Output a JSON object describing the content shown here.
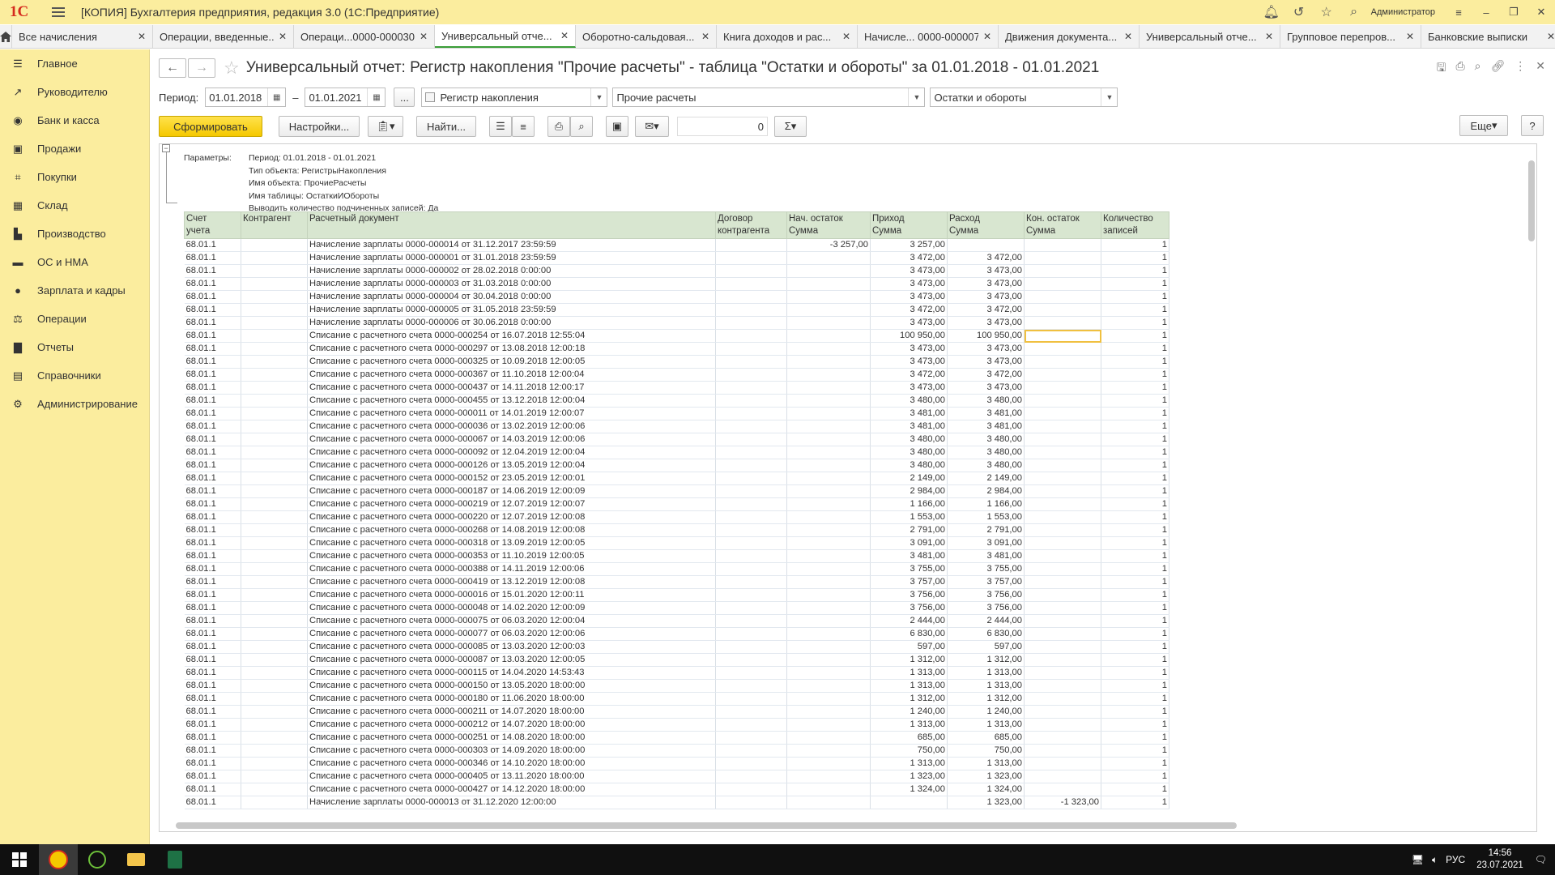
{
  "app": {
    "logo": "1С",
    "title": "[КОПИЯ] Бухгалтерия предприятия, редакция 3.0  (1С:Предприятие)",
    "user": "Администратор"
  },
  "tabs": [
    {
      "label": "Все начисления"
    },
    {
      "label": "Операции, введенные..."
    },
    {
      "label": "Операци...0000-000030"
    },
    {
      "label": "Универсальный отче...",
      "active": true
    },
    {
      "label": "Оборотно-сальдовая..."
    },
    {
      "label": "Книга доходов и рас..."
    },
    {
      "label": "Начисле... 0000-000007"
    },
    {
      "label": "Движения документа..."
    },
    {
      "label": "Универсальный отче..."
    },
    {
      "label": "Групповое перепров..."
    },
    {
      "label": "Банковские выписки"
    }
  ],
  "sidebar": [
    {
      "label": "Главное",
      "icon": "menu-icon"
    },
    {
      "label": "Руководителю",
      "icon": "chart-trend-icon"
    },
    {
      "label": "Банк и касса",
      "icon": "bank-icon"
    },
    {
      "label": "Продажи",
      "icon": "bag-icon"
    },
    {
      "label": "Покупки",
      "icon": "cart-icon"
    },
    {
      "label": "Склад",
      "icon": "warehouse-icon"
    },
    {
      "label": "Производство",
      "icon": "factory-icon"
    },
    {
      "label": "ОС и НМА",
      "icon": "truck-icon"
    },
    {
      "label": "Зарплата и кадры",
      "icon": "person-icon"
    },
    {
      "label": "Операции",
      "icon": "dt-kt-icon"
    },
    {
      "label": "Отчеты",
      "icon": "bar-chart-icon"
    },
    {
      "label": "Справочники",
      "icon": "book-icon"
    },
    {
      "label": "Администрирование",
      "icon": "gear-icon"
    }
  ],
  "page": {
    "title": "Универсальный отчет: Регистр накопления \"Прочие расчеты\" - таблица \"Остатки и обороты\" за 01.01.2018 - 01.01.2021",
    "period_label": "Период:",
    "date_from": "01.01.2018",
    "date_sep": "–",
    "ellipsis": "...",
    "object_type": "Регистр накопления",
    "object_name": "Прочие расчеты",
    "table_name": "Остатки и обороты",
    "btn_generate": "Сформировать",
    "btn_settings": "Настройки...",
    "btn_find": "Найти...",
    "sum_value": "0",
    "btn_more": "Еще",
    "btn_help": "?"
  },
  "params": {
    "label": "Параметры:",
    "lines": [
      "Период: 01.01.2018 - 01.01.2021",
      "Тип объекта: РегистрыНакопления",
      "Имя объекта: ПрочиеРасчеты",
      "Имя таблицы: ОстаткиИОбороты",
      "Выводить количество подчиненных записей: Да"
    ]
  },
  "table": {
    "headers": [
      [
        "Счет",
        "учета"
      ],
      [
        "Контрагент",
        ""
      ],
      [
        "Расчетный документ",
        ""
      ],
      [
        "Договор",
        "контрагента"
      ],
      [
        "Нач. остаток",
        "Сумма"
      ],
      [
        "Приход",
        "Сумма"
      ],
      [
        "Расход",
        "Сумма"
      ],
      [
        "Кон. остаток",
        "Сумма"
      ],
      [
        "Количество",
        "записей"
      ]
    ],
    "rows": [
      [
        "68.01.1",
        "",
        "Начисление зарплаты 0000-000014 от 31.12.2017 23:59:59",
        "",
        "-3 257,00",
        "3 257,00",
        "",
        "",
        "1"
      ],
      [
        "68.01.1",
        "",
        "Начисление зарплаты 0000-000001 от 31.01.2018 23:59:59",
        "",
        "",
        "3 472,00",
        "3 472,00",
        "",
        "1"
      ],
      [
        "68.01.1",
        "",
        "Начисление зарплаты 0000-000002 от 28.02.2018 0:00:00",
        "",
        "",
        "3 473,00",
        "3 473,00",
        "",
        "1"
      ],
      [
        "68.01.1",
        "",
        "Начисление зарплаты 0000-000003 от 31.03.2018 0:00:00",
        "",
        "",
        "3 473,00",
        "3 473,00",
        "",
        "1"
      ],
      [
        "68.01.1",
        "",
        "Начисление зарплаты 0000-000004 от 30.04.2018 0:00:00",
        "",
        "",
        "3 473,00",
        "3 473,00",
        "",
        "1"
      ],
      [
        "68.01.1",
        "",
        "Начисление зарплаты 0000-000005 от 31.05.2018 23:59:59",
        "",
        "",
        "3 472,00",
        "3 472,00",
        "",
        "1"
      ],
      [
        "68.01.1",
        "",
        "Начисление зарплаты 0000-000006 от 30.06.2018 0:00:00",
        "",
        "",
        "3 473,00",
        "3 473,00",
        "",
        "1"
      ],
      [
        "68.01.1",
        "",
        "Списание с расчетного счета 0000-000254 от 16.07.2018 12:55:04",
        "",
        "",
        "100 950,00",
        "100 950,00",
        "",
        "1"
      ],
      [
        "68.01.1",
        "",
        "Списание с расчетного счета 0000-000297 от 13.08.2018 12:00:18",
        "",
        "",
        "3 473,00",
        "3 473,00",
        "",
        "1"
      ],
      [
        "68.01.1",
        "",
        "Списание с расчетного счета 0000-000325 от 10.09.2018 12:00:05",
        "",
        "",
        "3 473,00",
        "3 473,00",
        "",
        "1"
      ],
      [
        "68.01.1",
        "",
        "Списание с расчетного счета 0000-000367 от 11.10.2018 12:00:04",
        "",
        "",
        "3 472,00",
        "3 472,00",
        "",
        "1"
      ],
      [
        "68.01.1",
        "",
        "Списание с расчетного счета 0000-000437 от 14.11.2018 12:00:17",
        "",
        "",
        "3 473,00",
        "3 473,00",
        "",
        "1"
      ],
      [
        "68.01.1",
        "",
        "Списание с расчетного счета 0000-000455 от 13.12.2018 12:00:04",
        "",
        "",
        "3 480,00",
        "3 480,00",
        "",
        "1"
      ],
      [
        "68.01.1",
        "",
        "Списание с расчетного счета 0000-000011 от 14.01.2019 12:00:07",
        "",
        "",
        "3 481,00",
        "3 481,00",
        "",
        "1"
      ],
      [
        "68.01.1",
        "",
        "Списание с расчетного счета 0000-000036 от 13.02.2019 12:00:06",
        "",
        "",
        "3 481,00",
        "3 481,00",
        "",
        "1"
      ],
      [
        "68.01.1",
        "",
        "Списание с расчетного счета 0000-000067 от 14.03.2019 12:00:06",
        "",
        "",
        "3 480,00",
        "3 480,00",
        "",
        "1"
      ],
      [
        "68.01.1",
        "",
        "Списание с расчетного счета 0000-000092 от 12.04.2019 12:00:04",
        "",
        "",
        "3 480,00",
        "3 480,00",
        "",
        "1"
      ],
      [
        "68.01.1",
        "",
        "Списание с расчетного счета 0000-000126 от 13.05.2019 12:00:04",
        "",
        "",
        "3 480,00",
        "3 480,00",
        "",
        "1"
      ],
      [
        "68.01.1",
        "",
        "Списание с расчетного счета 0000-000152 от 23.05.2019 12:00:01",
        "",
        "",
        "2 149,00",
        "2 149,00",
        "",
        "1"
      ],
      [
        "68.01.1",
        "",
        "Списание с расчетного счета 0000-000187 от 14.06.2019 12:00:09",
        "",
        "",
        "2 984,00",
        "2 984,00",
        "",
        "1"
      ],
      [
        "68.01.1",
        "",
        "Списание с расчетного счета 0000-000219 от 12.07.2019 12:00:07",
        "",
        "",
        "1 166,00",
        "1 166,00",
        "",
        "1"
      ],
      [
        "68.01.1",
        "",
        "Списание с расчетного счета 0000-000220 от 12.07.2019 12:00:08",
        "",
        "",
        "1 553,00",
        "1 553,00",
        "",
        "1"
      ],
      [
        "68.01.1",
        "",
        "Списание с расчетного счета 0000-000268 от 14.08.2019 12:00:08",
        "",
        "",
        "2 791,00",
        "2 791,00",
        "",
        "1"
      ],
      [
        "68.01.1",
        "",
        "Списание с расчетного счета 0000-000318 от 13.09.2019 12:00:05",
        "",
        "",
        "3 091,00",
        "3 091,00",
        "",
        "1"
      ],
      [
        "68.01.1",
        "",
        "Списание с расчетного счета 0000-000353 от 11.10.2019 12:00:05",
        "",
        "",
        "3 481,00",
        "3 481,00",
        "",
        "1"
      ],
      [
        "68.01.1",
        "",
        "Списание с расчетного счета 0000-000388 от 14.11.2019 12:00:06",
        "",
        "",
        "3 755,00",
        "3 755,00",
        "",
        "1"
      ],
      [
        "68.01.1",
        "",
        "Списание с расчетного счета 0000-000419 от 13.12.2019 12:00:08",
        "",
        "",
        "3 757,00",
        "3 757,00",
        "",
        "1"
      ],
      [
        "68.01.1",
        "",
        "Списание с расчетного счета 0000-000016 от 15.01.2020 12:00:11",
        "",
        "",
        "3 756,00",
        "3 756,00",
        "",
        "1"
      ],
      [
        "68.01.1",
        "",
        "Списание с расчетного счета 0000-000048 от 14.02.2020 12:00:09",
        "",
        "",
        "3 756,00",
        "3 756,00",
        "",
        "1"
      ],
      [
        "68.01.1",
        "",
        "Списание с расчетного счета 0000-000075 от 06.03.2020 12:00:04",
        "",
        "",
        "2 444,00",
        "2 444,00",
        "",
        "1"
      ],
      [
        "68.01.1",
        "",
        "Списание с расчетного счета 0000-000077 от 06.03.2020 12:00:06",
        "",
        "",
        "6 830,00",
        "6 830,00",
        "",
        "1"
      ],
      [
        "68.01.1",
        "",
        "Списание с расчетного счета 0000-000085 от 13.03.2020 12:00:03",
        "",
        "",
        "597,00",
        "597,00",
        "",
        "1"
      ],
      [
        "68.01.1",
        "",
        "Списание с расчетного счета 0000-000087 от 13.03.2020 12:00:05",
        "",
        "",
        "1 312,00",
        "1 312,00",
        "",
        "1"
      ],
      [
        "68.01.1",
        "",
        "Списание с расчетного счета 0000-000115 от 14.04.2020 14:53:43",
        "",
        "",
        "1 313,00",
        "1 313,00",
        "",
        "1"
      ],
      [
        "68.01.1",
        "",
        "Списание с расчетного счета 0000-000150 от 13.05.2020 18:00:00",
        "",
        "",
        "1 313,00",
        "1 313,00",
        "",
        "1"
      ],
      [
        "68.01.1",
        "",
        "Списание с расчетного счета 0000-000180 от 11.06.2020 18:00:00",
        "",
        "",
        "1 312,00",
        "1 312,00",
        "",
        "1"
      ],
      [
        "68.01.1",
        "",
        "Списание с расчетного счета 0000-000211 от 14.07.2020 18:00:00",
        "",
        "",
        "1 240,00",
        "1 240,00",
        "",
        "1"
      ],
      [
        "68.01.1",
        "",
        "Списание с расчетного счета 0000-000212 от 14.07.2020 18:00:00",
        "",
        "",
        "1 313,00",
        "1 313,00",
        "",
        "1"
      ],
      [
        "68.01.1",
        "",
        "Списание с расчетного счета 0000-000251 от 14.08.2020 18:00:00",
        "",
        "",
        "685,00",
        "685,00",
        "",
        "1"
      ],
      [
        "68.01.1",
        "",
        "Списание с расчетного счета 0000-000303 от 14.09.2020 18:00:00",
        "",
        "",
        "750,00",
        "750,00",
        "",
        "1"
      ],
      [
        "68.01.1",
        "",
        "Списание с расчетного счета 0000-000346 от 14.10.2020 18:00:00",
        "",
        "",
        "1 313,00",
        "1 313,00",
        "",
        "1"
      ],
      [
        "68.01.1",
        "",
        "Списание с расчетного счета 0000-000405 от 13.11.2020 18:00:00",
        "",
        "",
        "1 323,00",
        "1 323,00",
        "",
        "1"
      ],
      [
        "68.01.1",
        "",
        "Списание с расчетного счета 0000-000427 от 14.12.2020 18:00:00",
        "",
        "",
        "1 324,00",
        "1 324,00",
        "",
        "1"
      ],
      [
        "68.01.1",
        "",
        "Начисление зарплаты 0000-000013 от 31.12.2020 12:00:00",
        "",
        "",
        "",
        "1 323,00",
        "-1 323,00",
        "1"
      ]
    ],
    "selected_row": 7,
    "selected_col": 7
  },
  "taskbar": {
    "lang": "РУС",
    "time": "14:56",
    "date": "23.07.2021"
  }
}
